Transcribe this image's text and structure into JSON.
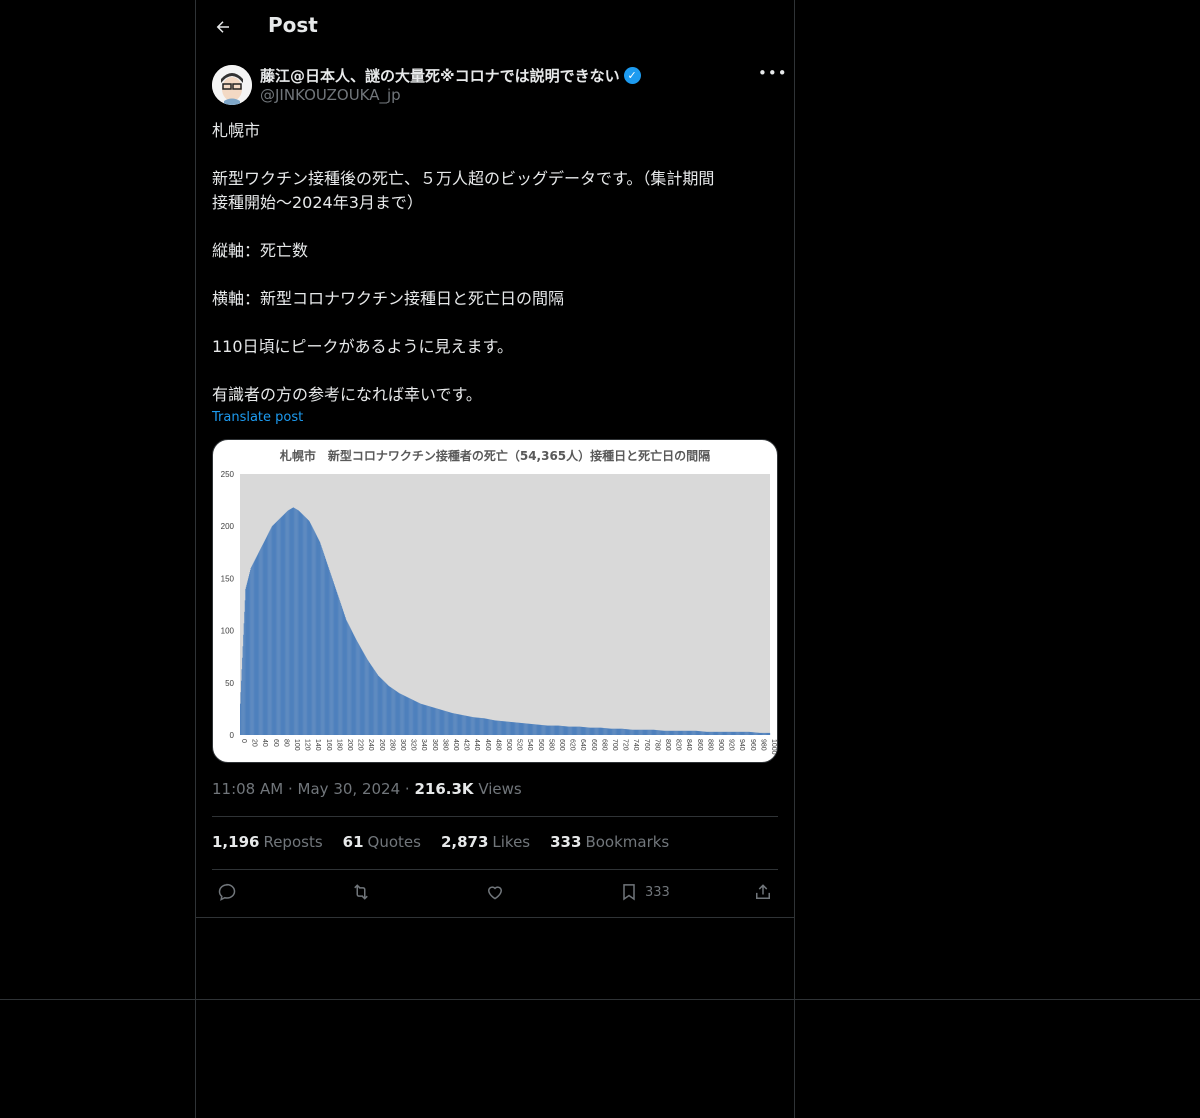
{
  "header": {
    "title": "Post",
    "back_icon": "arrow-left-icon"
  },
  "author": {
    "name": "藤江@日本人、謎の大量死※コロナでは説明できない",
    "handle": "@JINKOUZOUKA_jp",
    "verified_color": "#1d9bf0"
  },
  "tweet": {
    "paragraphs": [
      "札幌市",
      "新型ワクチン接種後の死亡、５万人超のビッグデータです。（集計期間\n接種開始〜2024年3月まで）",
      "縦軸：死亡数",
      "横軸：新型コロナワクチン接種日と死亡日の間隔",
      "110日頃にピークがあるように見えます。",
      "有識者の方の参考になれば幸いです。"
    ],
    "translate_label": "Translate post"
  },
  "meta": {
    "time": "11:08 AM",
    "date": "May 30, 2024",
    "views_count": "216.3K",
    "views_label": "Views",
    "sep": "·"
  },
  "stats": [
    {
      "count": "1,196",
      "label": "Reposts"
    },
    {
      "count": "61",
      "label": "Quotes"
    },
    {
      "count": "2,873",
      "label": "Likes"
    },
    {
      "count": "333",
      "label": "Bookmarks"
    }
  ],
  "actions": {
    "bookmark_count": "333"
  },
  "chart_data": {
    "type": "bar",
    "title": "札幌市　新型コロナワクチン接種者の死亡（54,365人）接種日と死亡日の間隔",
    "xlabel": "",
    "ylabel": "",
    "xlim": [
      0,
      1000
    ],
    "ylim": [
      0,
      250
    ],
    "y_ticks": [
      0,
      50,
      100,
      150,
      200,
      250
    ],
    "x_ticks": [
      0,
      20,
      40,
      60,
      80,
      100,
      120,
      140,
      160,
      180,
      200,
      220,
      240,
      260,
      280,
      300,
      320,
      340,
      360,
      380,
      400,
      420,
      440,
      460,
      480,
      500,
      520,
      540,
      560,
      580,
      600,
      620,
      640,
      660,
      680,
      700,
      720,
      740,
      760,
      780,
      800,
      820,
      840,
      860,
      880,
      900,
      920,
      940,
      960,
      980,
      1000
    ],
    "bar_color": "#4f81bd",
    "plot_bg": "#d9d9d9",
    "x": [
      0,
      10,
      20,
      30,
      40,
      50,
      60,
      70,
      80,
      90,
      100,
      110,
      120,
      130,
      140,
      150,
      160,
      170,
      180,
      190,
      200,
      220,
      240,
      260,
      280,
      300,
      320,
      340,
      360,
      380,
      400,
      420,
      440,
      460,
      480,
      500,
      520,
      540,
      560,
      580,
      600,
      620,
      640,
      660,
      680,
      700,
      720,
      740,
      760,
      780,
      800,
      820,
      840,
      860,
      880,
      900,
      920,
      940,
      960,
      980,
      1000
    ],
    "values": [
      30,
      140,
      160,
      170,
      180,
      190,
      200,
      205,
      210,
      215,
      218,
      215,
      210,
      205,
      195,
      185,
      170,
      155,
      140,
      125,
      110,
      90,
      72,
      57,
      47,
      40,
      35,
      30,
      27,
      24,
      21,
      19,
      17,
      16,
      14,
      13,
      12,
      11,
      10,
      9,
      9,
      8,
      8,
      7,
      7,
      6,
      6,
      5,
      5,
      5,
      4,
      4,
      4,
      4,
      3,
      3,
      3,
      3,
      3,
      2,
      2
    ]
  }
}
